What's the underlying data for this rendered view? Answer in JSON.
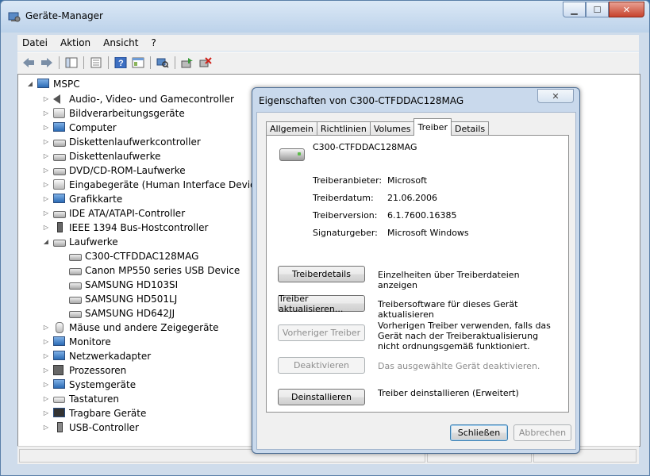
{
  "window": {
    "title": "Geräte-Manager",
    "caption_minimize": "▁",
    "caption_maximize": "☐",
    "caption_close": "✕"
  },
  "menu": [
    "Datei",
    "Aktion",
    "Ansicht",
    "?"
  ],
  "toolbar": [
    "back-icon",
    "forward-icon",
    "show-hide-tree-icon",
    "properties-icon",
    "help-icon",
    "view-icon",
    "scan-hardware-icon",
    "update-driver-icon",
    "uninstall-icon"
  ],
  "tree": {
    "root": "MSPC",
    "categories": [
      "Audio-, Video- und Gamecontroller",
      "Bildverarbeitungsgeräte",
      "Computer",
      "Diskettenlaufwerkcontroller",
      "Diskettenlaufwerke",
      "DVD/CD-ROM-Laufwerke",
      "Eingabegeräte (Human Interface Devices)",
      "Grafikkarte",
      "IDE ATA/ATAPI-Controller",
      "IEEE 1394 Bus-Hostcontroller",
      "Laufwerke"
    ],
    "drives": [
      "C300-CTFDDAC128MAG",
      "Canon MP550 series USB Device",
      "SAMSUNG HD103SI",
      "SAMSUNG HD501LJ",
      "SAMSUNG HD642JJ"
    ],
    "categories_after": [
      "Mäuse und andere Zeigegeräte",
      "Monitore",
      "Netzwerkadapter",
      "Prozessoren",
      "Systemgeräte",
      "Tastaturen",
      "Tragbare Geräte",
      "USB-Controller"
    ]
  },
  "dialog": {
    "title": "Eigenschaften von C300-CTFDDAC128MAG",
    "close_label": "✕",
    "tabs": [
      "Allgemein",
      "Richtlinien",
      "Volumes",
      "Treiber",
      "Details"
    ],
    "active_tab": "Treiber",
    "device_name": "C300-CTFDDAC128MAG",
    "props": [
      {
        "label": "Treiberanbieter:",
        "value": "Microsoft"
      },
      {
        "label": "Treiberdatum:",
        "value": "21.06.2006"
      },
      {
        "label": "Treiberversion:",
        "value": "6.1.7600.16385"
      },
      {
        "label": "Signaturgeber:",
        "value": "Microsoft Windows"
      }
    ],
    "actions": [
      {
        "button": "Treiberdetails",
        "desc": "Einzelheiten über Treiberdateien anzeigen",
        "enabled": true
      },
      {
        "button": "Treiber aktualisieren...",
        "desc": "Treibersoftware für dieses Gerät aktualisieren",
        "enabled": true
      },
      {
        "button": "Vorheriger Treiber",
        "desc": "Vorherigen Treiber verwenden, falls das Gerät nach der Treiberaktualisierung nicht ordnungsgemäß funktioniert.",
        "enabled": false
      },
      {
        "button": "Deaktivieren",
        "desc": "Das ausgewählte Gerät deaktivieren.",
        "enabled": false
      },
      {
        "button": "Deinstallieren",
        "desc": "Treiber deinstallieren (Erweitert)",
        "enabled": true
      }
    ],
    "ok_label": "Schließen",
    "cancel_label": "Abbrechen"
  }
}
